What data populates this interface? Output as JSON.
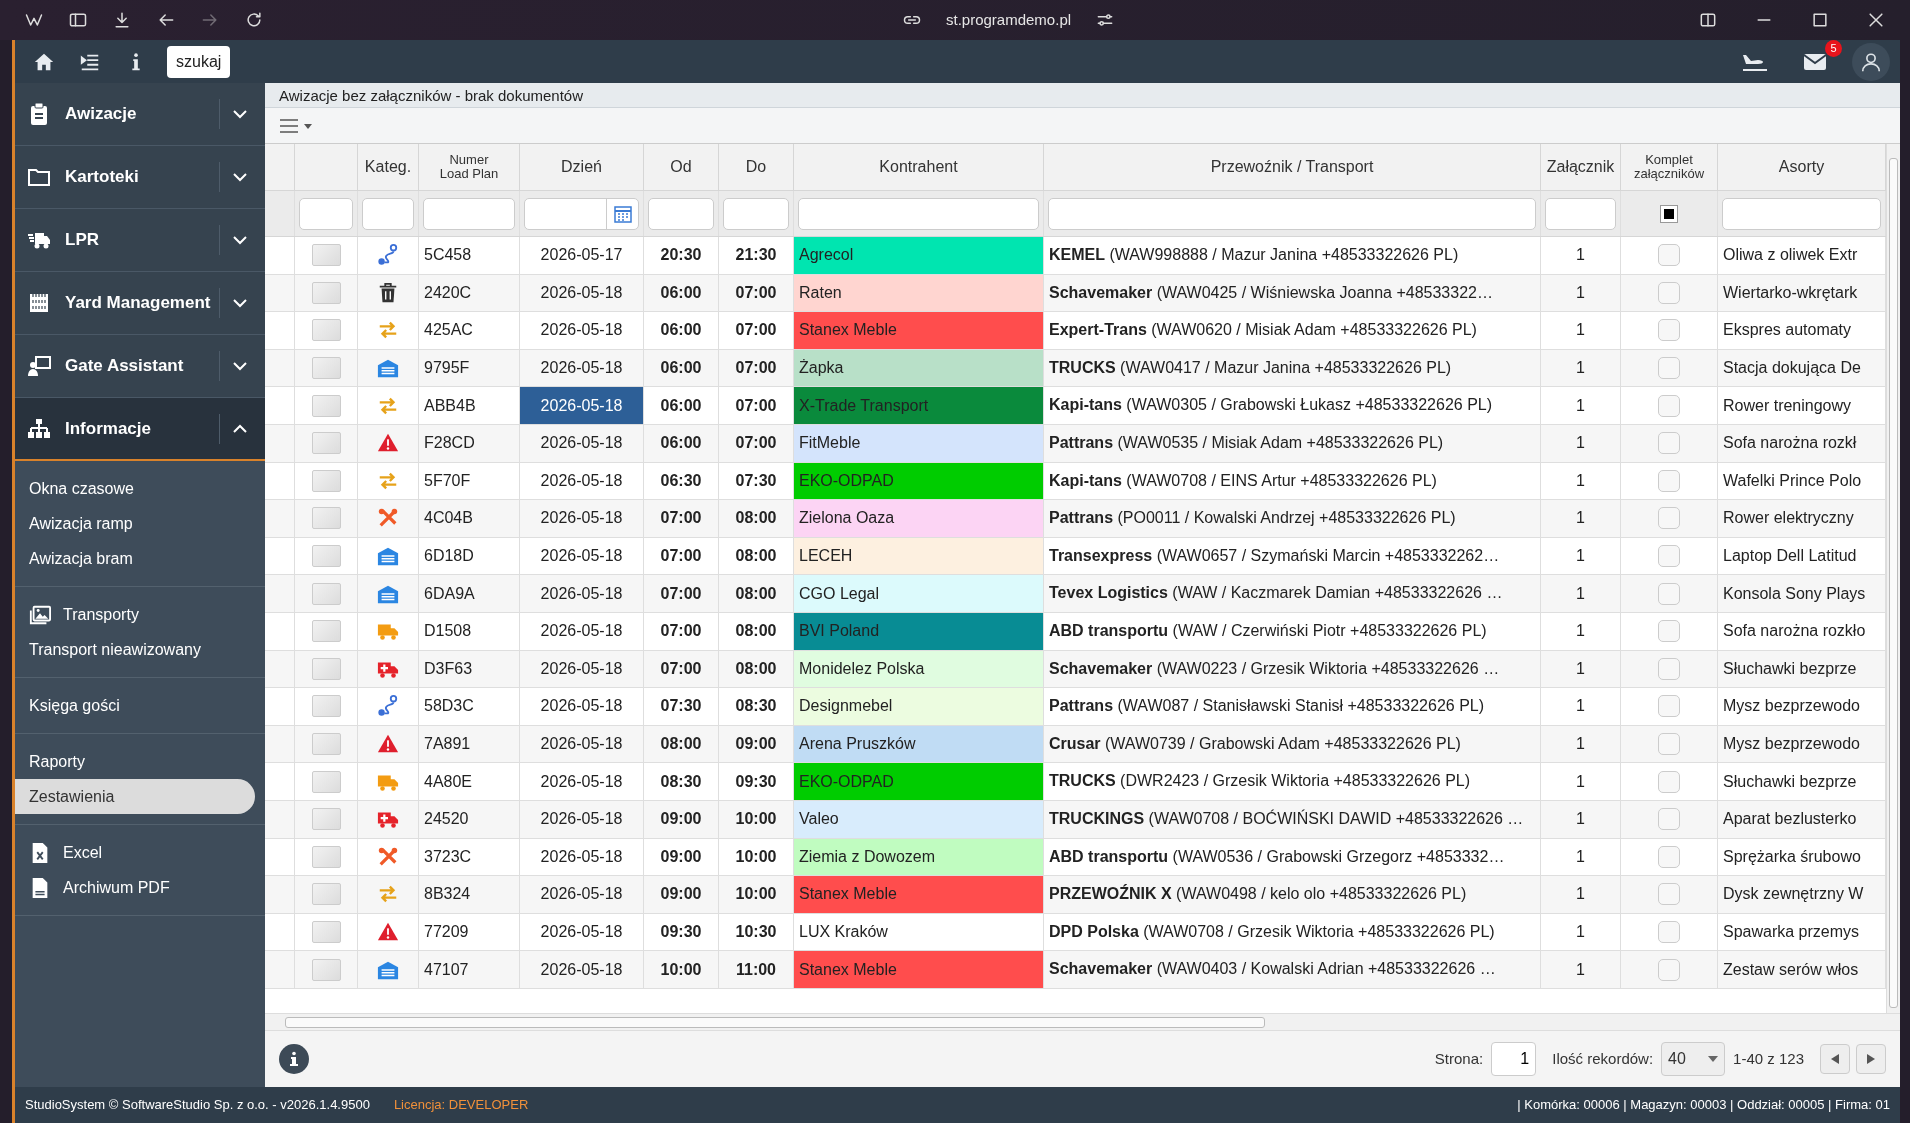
{
  "browser": {
    "url": "st.programdemo.pl"
  },
  "topbar": {
    "search": "szukaj",
    "mail_badge": "5"
  },
  "sidebar": {
    "groups": [
      {
        "label": "Awizacje",
        "kind": "clipboard",
        "expanded": false
      },
      {
        "label": "Kartoteki",
        "kind": "folder",
        "expanded": false
      },
      {
        "label": "LPR",
        "kind": "truck",
        "expanded": false
      },
      {
        "label": "Yard Management",
        "kind": "checker",
        "expanded": false
      },
      {
        "label": "Gate Assistant",
        "kind": "presenter",
        "expanded": false
      },
      {
        "label": "Informacje",
        "kind": "sitemap",
        "expanded": true
      }
    ],
    "sections": [
      [
        {
          "label": "Okna czasowe",
          "kind": "text",
          "selected": false
        },
        {
          "label": "Awizacja ramp",
          "kind": "text",
          "selected": false
        },
        {
          "label": "Awizacja bram",
          "kind": "text",
          "selected": false
        }
      ],
      [
        {
          "label": "Transporty",
          "kind": "images",
          "selected": false
        },
        {
          "label": "Transport nieawizowany",
          "kind": "text",
          "selected": false
        }
      ],
      [
        {
          "label": "Księga gości",
          "kind": "text",
          "selected": false
        }
      ],
      [
        {
          "label": "Raporty",
          "kind": "text",
          "selected": false
        },
        {
          "label": "Zestawienia",
          "kind": "text",
          "selected": true
        }
      ],
      [
        {
          "label": "Excel",
          "kind": "excel",
          "selected": false
        },
        {
          "label": "Archiwum PDF",
          "kind": "pdf",
          "selected": false
        }
      ]
    ]
  },
  "page": {
    "title": "Awizacje bez załączników - brak dokumentów"
  },
  "grid": {
    "columns": [
      [
        "Kateg."
      ],
      [
        "Numer",
        "Load Plan"
      ],
      [
        "Dzień"
      ],
      [
        "Od"
      ],
      [
        "Do"
      ],
      [
        "Kontrahent"
      ],
      [
        "Przewoźnik / Transport"
      ],
      [
        "Załącznik"
      ],
      [
        "Komplet",
        "załączników"
      ],
      [
        "Asorty"
      ]
    ],
    "complete_filter": {
      "indeterminate": true
    },
    "rows": [
      {
        "checked": false,
        "kind": "route",
        "number": "5C458",
        "date": "2026-05-17",
        "selected": false,
        "from": "20:30",
        "to": "21:30",
        "contractor": "Agrecol",
        "color": "#00e5b0",
        "carrier": "**KEMEL** (WAW998888 / Mazur Janina +48533322626 PL)",
        "attachments": "1",
        "complete": false,
        "assortment": "Oliwa z oliwek Extr"
      },
      {
        "checked": false,
        "kind": "trash",
        "number": "2420C",
        "date": "2026-05-18",
        "selected": false,
        "from": "06:00",
        "to": "07:00",
        "contractor": "Raten",
        "color": "#ffd5d0",
        "carrier": "**Schavemaker** (WAW0425 / Wiśniewska Joanna +48533322…",
        "attachments": "1",
        "complete": false,
        "assortment": "Wiertarko-wkrętark"
      },
      {
        "checked": false,
        "kind": "swap",
        "number": "425AC",
        "date": "2026-05-18",
        "selected": false,
        "from": "06:00",
        "to": "07:00",
        "contractor": "Stanex Meble",
        "color": "#ff4d4d",
        "carrier": "**Expert-Trans** (WAW0620 / Misiak Adam +48533322626 PL)",
        "attachments": "1",
        "complete": false,
        "assortment": "Ekspres automaty"
      },
      {
        "checked": false,
        "kind": "garage",
        "number": "9795F",
        "date": "2026-05-18",
        "selected": false,
        "from": "06:00",
        "to": "07:00",
        "contractor": "Żapka",
        "color": "#b8e0c8",
        "carrier": "**TRUCKS** (WAW0417 / Mazur Janina +48533322626 PL)",
        "attachments": "1",
        "complete": false,
        "assortment": "Stacja dokująca De"
      },
      {
        "checked": false,
        "kind": "swap",
        "number": "ABB4B",
        "date": "2026-05-18",
        "selected": true,
        "from": "06:00",
        "to": "07:00",
        "contractor": "X-Trade Transport",
        "color": "#0a8a3c",
        "carrier": "**Kapi-tans** (WAW0305 / Grabowski Łukasz +48533322626 PL)",
        "attachments": "1",
        "complete": false,
        "assortment": "Rower treningowy"
      },
      {
        "checked": false,
        "kind": "warning",
        "number": "F28CD",
        "date": "2026-05-18",
        "selected": false,
        "from": "06:00",
        "to": "07:00",
        "contractor": "FitMeble",
        "color": "#d4e4fc",
        "carrier": "**Pattrans** (WAW0535 / Misiak Adam +48533322626 PL)",
        "attachments": "1",
        "complete": false,
        "assortment": "Sofa narożna rozkł"
      },
      {
        "checked": false,
        "kind": "swap",
        "number": "5F70F",
        "date": "2026-05-18",
        "selected": false,
        "from": "06:30",
        "to": "07:30",
        "contractor": "EKO-ODPAD",
        "color": "#00cc00",
        "carrier": "**Kapi-tans** (WAW0708 / EINS Artur +48533322626 PL)",
        "attachments": "1",
        "complete": false,
        "assortment": "Wafelki Prince Polo"
      },
      {
        "checked": false,
        "kind": "tools",
        "number": "4C04B",
        "date": "2026-05-18",
        "selected": false,
        "from": "07:00",
        "to": "08:00",
        "contractor": "Zielona Oaza",
        "color": "#fcd4f4",
        "carrier": "**Pattrans** (PO0011 / Kowalski Andrzej +48533322626 PL)",
        "attachments": "1",
        "complete": false,
        "assortment": "Rower elektryczny"
      },
      {
        "checked": false,
        "kind": "garage",
        "number": "6D18D",
        "date": "2026-05-18",
        "selected": false,
        "from": "07:00",
        "to": "08:00",
        "contractor": "LECEH",
        "color": "#fdf0e0",
        "carrier": "**Transexpress** (WAW0657 / Szymański Marcin +4853332262…",
        "attachments": "1",
        "complete": false,
        "assortment": "Laptop Dell Latitud"
      },
      {
        "checked": false,
        "kind": "garage",
        "number": "6DA9A",
        "date": "2026-05-18",
        "selected": false,
        "from": "07:00",
        "to": "08:00",
        "contractor": "CGO Legal",
        "color": "#dcfafc",
        "carrier": "**Tevex Logistics** (WAW / Kaczmarek Damian +48533322626 …",
        "attachments": "1",
        "complete": false,
        "assortment": "Konsola Sony Plays"
      },
      {
        "checked": false,
        "kind": "truck",
        "number": "D1508",
        "date": "2026-05-18",
        "selected": false,
        "from": "07:00",
        "to": "08:00",
        "contractor": "BVI Poland",
        "color": "#088c94",
        "carrier": "**ABD transportu** (WAW / Czerwiński Piotr +48533322626 PL)",
        "attachments": "1",
        "complete": false,
        "assortment": "Sofa narożna rozkło"
      },
      {
        "checked": false,
        "kind": "ambulance",
        "number": "D3F63",
        "date": "2026-05-18",
        "selected": false,
        "from": "07:00",
        "to": "08:00",
        "contractor": "Monidelez Polska",
        "color": "#e0fce0",
        "carrier": "**Schavemaker** (WAW0223 / Grzesik Wiktoria +48533322626 …",
        "attachments": "1",
        "complete": false,
        "assortment": "Słuchawki bezprze"
      },
      {
        "checked": false,
        "kind": "route",
        "number": "58D3C",
        "date": "2026-05-18",
        "selected": false,
        "from": "07:30",
        "to": "08:30",
        "contractor": "Designmebel",
        "color": "#ecfce0",
        "carrier": "**Pattrans** (WAW087 / Stanisławski Stanisł +48533322626 PL)",
        "attachments": "1",
        "complete": false,
        "assortment": "Mysz bezprzewodo"
      },
      {
        "checked": false,
        "kind": "warning",
        "number": "7A891",
        "date": "2026-05-18",
        "selected": false,
        "from": "08:00",
        "to": "09:00",
        "contractor": "Arena Pruszków",
        "color": "#c0dcf4",
        "carrier": "**Crusar** (WAW0739 / Grabowski Adam +48533322626 PL)",
        "attachments": "1",
        "complete": false,
        "assortment": "Mysz bezprzewodo"
      },
      {
        "checked": false,
        "kind": "truck",
        "number": "4A80E",
        "date": "2026-05-18",
        "selected": false,
        "from": "08:30",
        "to": "09:30",
        "contractor": "EKO-ODPAD",
        "color": "#00cc00",
        "carrier": "**TRUCKS** (DWR2423 / Grzesik Wiktoria +48533322626 PL)",
        "attachments": "1",
        "complete": false,
        "assortment": "Słuchawki bezprze"
      },
      {
        "checked": false,
        "kind": "ambulance",
        "number": "24520",
        "date": "2026-05-18",
        "selected": false,
        "from": "09:00",
        "to": "10:00",
        "contractor": "Valeo",
        "color": "#d8ecfc",
        "carrier": "**TRUCKINGS** (WAW0708 / BOĆWIŃSKI DAWID +48533322626 …",
        "attachments": "1",
        "complete": false,
        "assortment": "Aparat bezlusterko"
      },
      {
        "checked": false,
        "kind": "tools",
        "number": "3723C",
        "date": "2026-05-18",
        "selected": false,
        "from": "09:00",
        "to": "10:00",
        "contractor": "Ziemia z Dowozem",
        "color": "#c0fcc0",
        "carrier": "**ABD transportu** (WAW0536 / Grabowski Grzegorz +4853332…",
        "attachments": "1",
        "complete": false,
        "assortment": "Sprężarka śrubowo"
      },
      {
        "checked": false,
        "kind": "swap",
        "number": "8B324",
        "date": "2026-05-18",
        "selected": false,
        "from": "09:00",
        "to": "10:00",
        "contractor": "Stanex Meble",
        "color": "#ff4d4d",
        "carrier": "**PRZEWOŹNIK X** (WAW0498 / kelo olo +48533322626 PL)",
        "attachments": "1",
        "complete": false,
        "assortment": "Dysk zewnętrzny W"
      },
      {
        "checked": false,
        "kind": "warning",
        "number": "77209",
        "date": "2026-05-18",
        "selected": false,
        "from": "09:30",
        "to": "10:30",
        "contractor": "LUX Kraków",
        "color": "#ffffff",
        "carrier": "**DPD Polska** (WAW0708 / Grzesik Wiktoria +48533322626 PL)",
        "attachments": "1",
        "complete": false,
        "assortment": "Spawarka przemys"
      },
      {
        "checked": false,
        "kind": "garage",
        "number": "47107",
        "date": "2026-05-18",
        "selected": false,
        "from": "10:00",
        "to": "11:00",
        "contractor": "Stanex Meble",
        "color": "#ff4d4d",
        "carrier": "**Schavemaker** (WAW0403 / Kowalski Adrian +48533322626 …",
        "attachments": "1",
        "complete": false,
        "assortment": "Zestaw serów włos"
      }
    ]
  },
  "pager": {
    "page_label": "Strona:",
    "page": "1",
    "size_label": "Ilość rekordów:",
    "size": "40",
    "range": "1-40 z 123"
  },
  "status": {
    "left": "StudioSystem © SoftwareStudio Sp. z o.o. - v2026.1.4.9500",
    "license": "Licencja: DEVELOPER",
    "right": "| Komórka: 00006 | Magazyn: 00003 | Oddział: 00005 | Firma: 01"
  }
}
